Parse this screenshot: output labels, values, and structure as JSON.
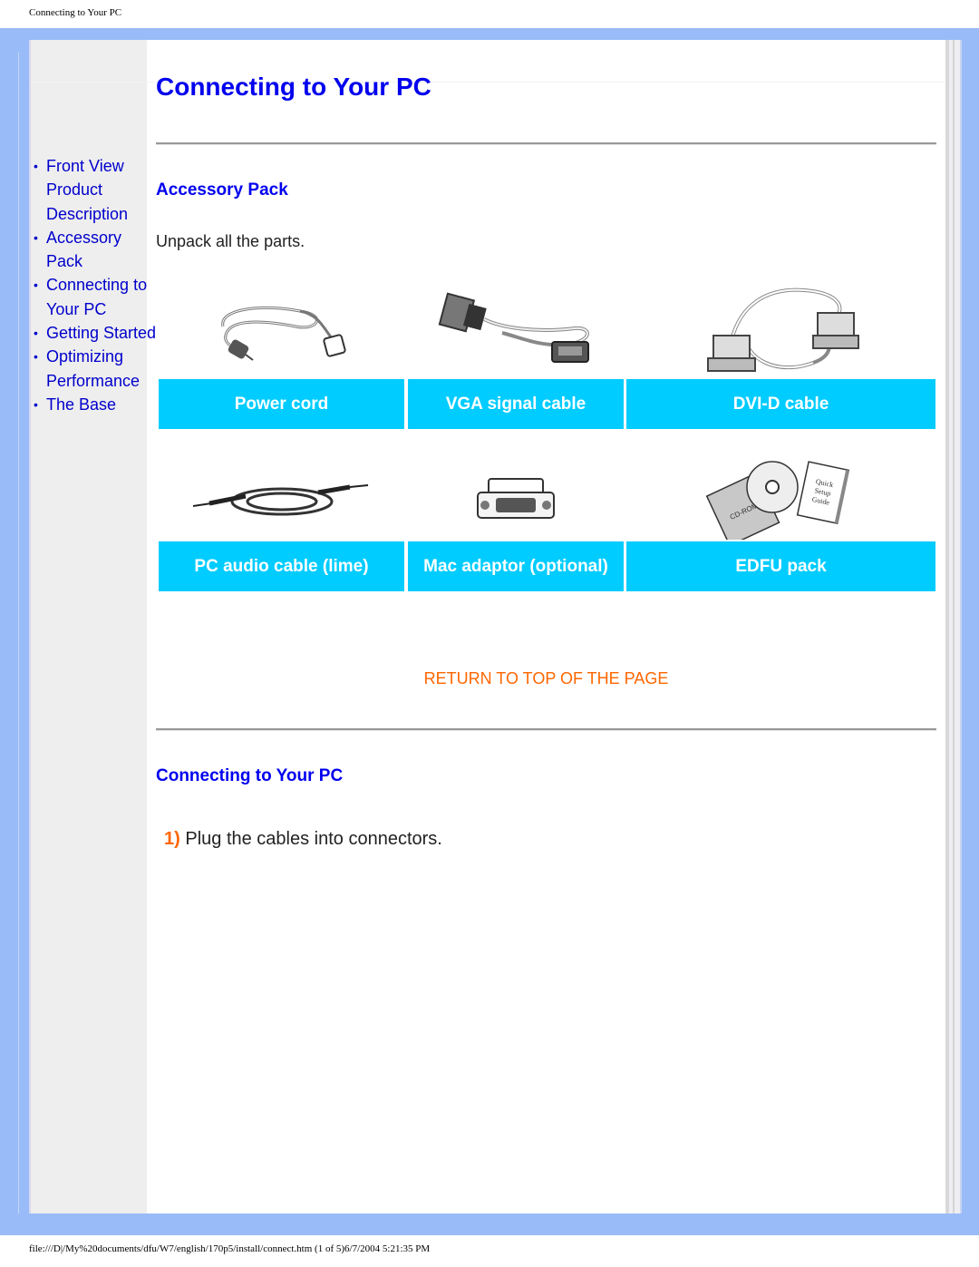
{
  "print_header": "Connecting to Your PC",
  "print_footer": "file:///D|/My%20documents/dfu/W7/english/170p5/install/connect.htm (1 of 5)6/7/2004 5:21:35 PM",
  "page_title": "Connecting to Your PC",
  "sidebar": {
    "items": [
      {
        "label": "Front View Product Description"
      },
      {
        "label": "Accessory Pack"
      },
      {
        "label": "Connecting to Your PC"
      },
      {
        "label": "Getting Started"
      },
      {
        "label": "Optimizing Performance"
      },
      {
        "label": "The Base"
      }
    ],
    "bullet": "•"
  },
  "accessory": {
    "heading": "Accessory Pack",
    "intro": "Unpack all the parts.",
    "items": [
      {
        "label": "Power cord",
        "icon": "power-cord-icon"
      },
      {
        "label": "VGA signal cable",
        "icon": "vga-cable-icon"
      },
      {
        "label": "DVI-D cable",
        "icon": "dvi-cable-icon"
      },
      {
        "label": "PC audio cable (lime)",
        "icon": "audio-cable-icon"
      },
      {
        "label": "Mac adaptor (optional)",
        "icon": "mac-adaptor-icon"
      },
      {
        "label": "EDFU pack",
        "icon": "edfu-pack-icon"
      }
    ],
    "edfu_cd_text": "CD-ROM",
    "edfu_guide_text": "Quick Setup Guide"
  },
  "return_link": "RETURN TO TOP OF THE PAGE",
  "connect": {
    "heading": "Connecting to Your PC",
    "steps": [
      {
        "num": "1)",
        "text": "Plug the cables into connectors."
      }
    ]
  },
  "colors": {
    "frame": "#99bbf7",
    "label_bg": "#00ccff",
    "heading": "#0000ee",
    "link_orange": "#ff6600"
  }
}
